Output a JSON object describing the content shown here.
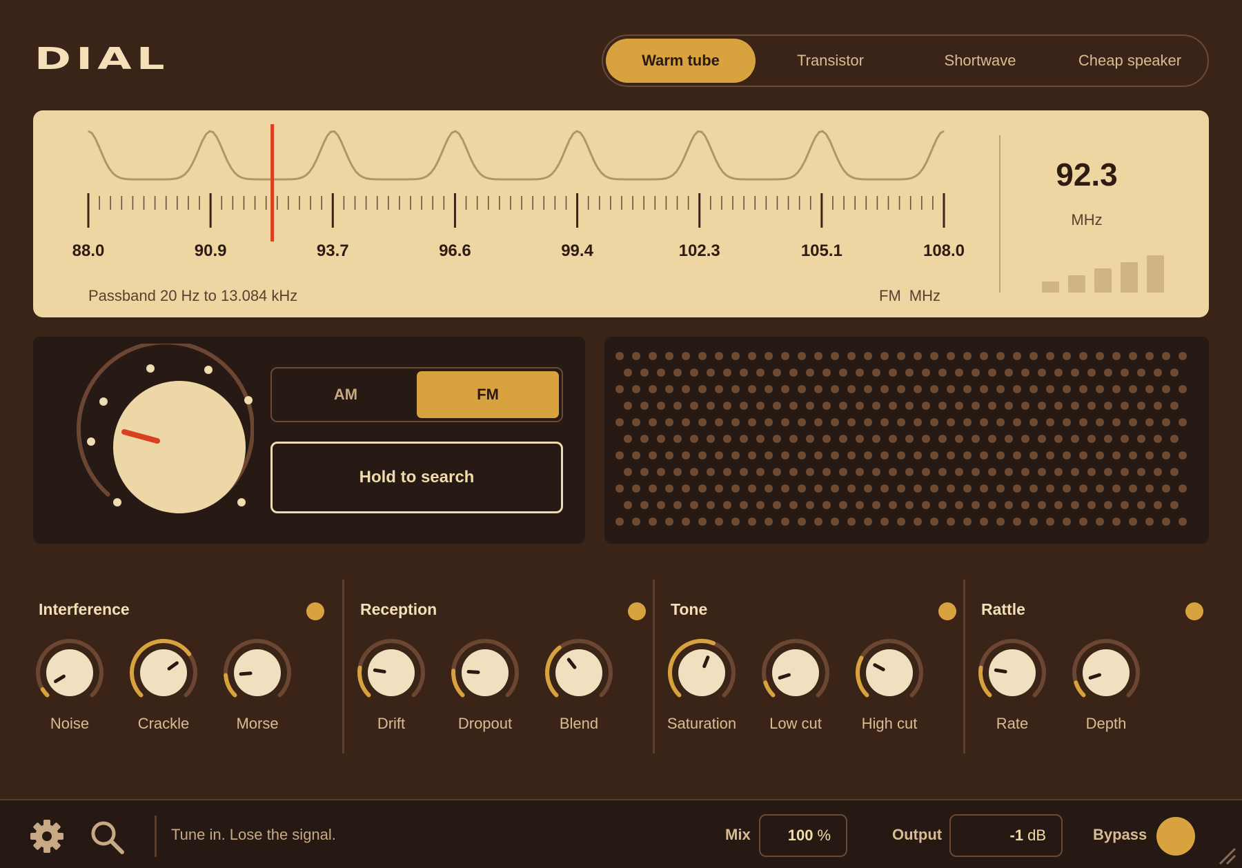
{
  "app": {
    "title": "DIAL"
  },
  "presets": [
    {
      "label": "Warm tube",
      "active": true
    },
    {
      "label": "Transistor",
      "active": false
    },
    {
      "label": "Shortwave",
      "active": false
    },
    {
      "label": "Cheap speaker",
      "active": false
    }
  ],
  "dial": {
    "frequency_labels": [
      "88.0",
      "90.9",
      "93.7",
      "96.6",
      "99.4",
      "102.3",
      "105.1",
      "108.0"
    ],
    "min_mhz": 88.0,
    "max_mhz": 108.0,
    "tuned_mhz": 92.3,
    "passband": "Passband 20 Hz to 13.084 kHz",
    "band": "FM",
    "unit": "MHz",
    "readout": "92.3",
    "readout_unit": "MHz",
    "signal_bars_total": 5,
    "colors": {
      "needle": "#d94020",
      "panel": "#edd6a2",
      "accent": "#d8a23f"
    }
  },
  "tuner": {
    "knob_icon": "tuning-knob",
    "band_options": [
      {
        "label": "AM",
        "active": false
      },
      {
        "label": "FM",
        "active": true
      }
    ],
    "search_label": "Hold to search"
  },
  "speaker": {
    "icon": "speaker-grille"
  },
  "sections": [
    {
      "title": "Interference",
      "enabled": true,
      "knobs": [
        {
          "label": "Noise",
          "value": 0.05
        },
        {
          "label": "Crackle",
          "value": 0.7
        },
        {
          "label": "Morse",
          "value": 0.15
        }
      ]
    },
    {
      "title": "Reception",
      "enabled": true,
      "knobs": [
        {
          "label": "Drift",
          "value": 0.2
        },
        {
          "label": "Dropout",
          "value": 0.18
        },
        {
          "label": "Blend",
          "value": 0.36
        }
      ]
    },
    {
      "title": "Tone",
      "enabled": true,
      "knobs": [
        {
          "label": "Saturation",
          "value": 0.58
        },
        {
          "label": "Low cut",
          "value": 0.1
        },
        {
          "label": "High cut",
          "value": 0.27
        }
      ]
    },
    {
      "title": "Rattle",
      "enabled": true,
      "knobs": [
        {
          "label": "Rate",
          "value": 0.2
        },
        {
          "label": "Depth",
          "value": 0.1
        }
      ]
    }
  ],
  "footer": {
    "settings_icon": "gear-icon",
    "search_icon": "search-icon",
    "tagline": "Tune in. Lose the signal.",
    "mix_label": "Mix",
    "mix_value": "100",
    "mix_unit": "%",
    "output_label": "Output",
    "output_value": "-1",
    "output_unit": "dB",
    "bypass_label": "Bypass",
    "bypass_on": true
  }
}
